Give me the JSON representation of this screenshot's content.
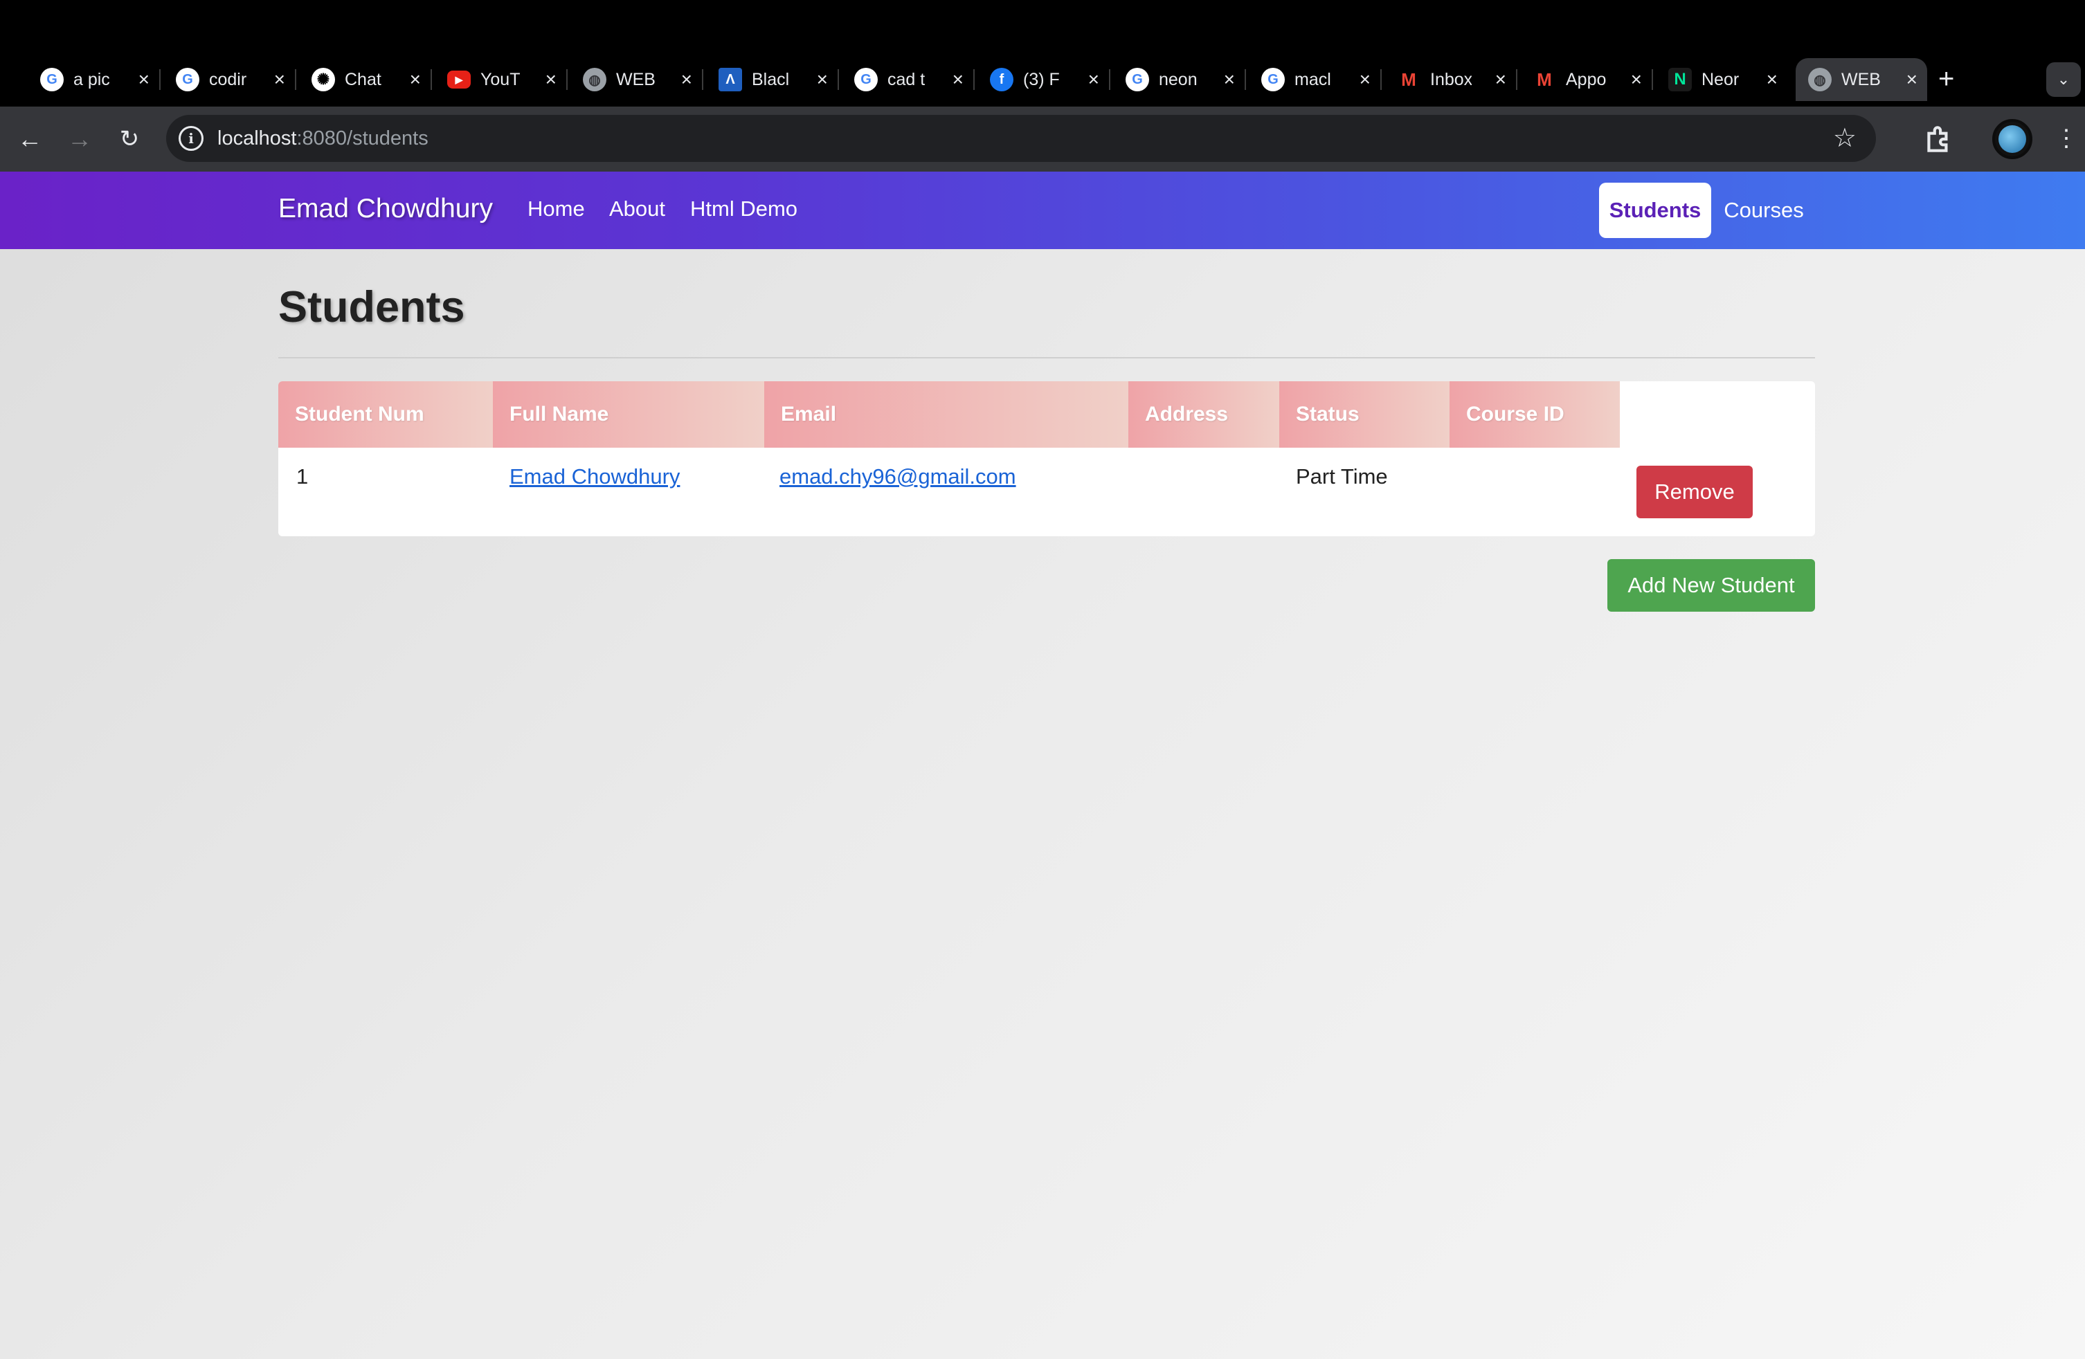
{
  "browser": {
    "tabs": [
      {
        "label": "a pic",
        "icon": "google-icon",
        "active": false
      },
      {
        "label": "codir",
        "icon": "google-icon",
        "active": false
      },
      {
        "label": "Chat",
        "icon": "chatgpt-icon",
        "active": false
      },
      {
        "label": "YouT",
        "icon": "youtube-icon",
        "active": false
      },
      {
        "label": "WEB",
        "icon": "globe-icon",
        "active": false
      },
      {
        "label": "Blacl",
        "icon": "blackboard-icon",
        "active": false
      },
      {
        "label": "cad t",
        "icon": "google-icon",
        "active": false
      },
      {
        "label": "(3) F",
        "icon": "facebook-icon",
        "active": false
      },
      {
        "label": "neon",
        "icon": "google-icon",
        "active": false
      },
      {
        "label": "macl",
        "icon": "google-icon",
        "active": false
      },
      {
        "label": "Inbox",
        "icon": "gmail-icon",
        "active": false
      },
      {
        "label": "Appo",
        "icon": "gmail-icon",
        "active": false
      },
      {
        "label": "Neor",
        "icon": "neon-icon",
        "active": false
      },
      {
        "label": "WEB",
        "icon": "globe-icon",
        "active": true
      }
    ],
    "url_host": "localhost",
    "url_rest": ":8080/students"
  },
  "navbar": {
    "brand": "Emad Chowdhury",
    "links": [
      "Home",
      "About",
      "Html Demo"
    ],
    "right_links": [
      {
        "label": "Students",
        "active": true
      },
      {
        "label": "Courses",
        "active": false
      }
    ]
  },
  "page": {
    "title": "Students",
    "add_button": "Add New Student"
  },
  "table": {
    "columns": [
      "Student Num",
      "Full Name",
      "Email",
      "Address",
      "Status",
      "Course ID",
      ""
    ],
    "rows": [
      {
        "student_num": "1",
        "full_name": "Emad Chowdhury",
        "email": "emad.chy96@gmail.com",
        "address": "",
        "status": "Part Time",
        "course_id": "",
        "action": "Remove"
      }
    ]
  },
  "colors": {
    "nav_gradient_start": "#6a22c8",
    "nav_gradient_end": "#3f7bf0",
    "header_cell": "#efa3a7",
    "remove_button": "#cf3b47",
    "add_button": "#4ea54f",
    "link": "#1a63d6"
  }
}
